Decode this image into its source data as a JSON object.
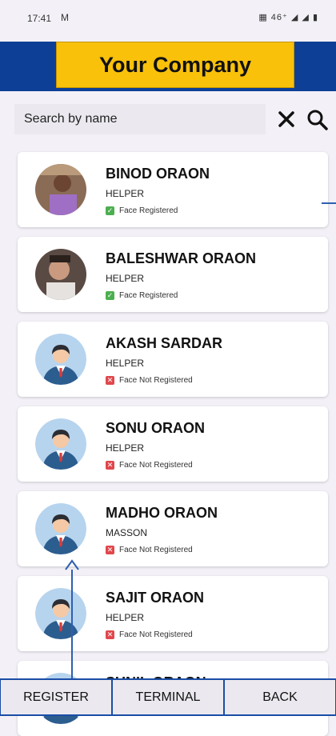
{
  "status_bar": {
    "time": "17:41",
    "net_icon": "M",
    "system": "▦ 46⁺ ◢ ◢ ▮"
  },
  "header": {
    "company": "Your Company"
  },
  "search": {
    "placeholder": "Search by name"
  },
  "employees": [
    {
      "name": "BINOD ORAON",
      "role": "HELPER",
      "face_status": "Face Registered",
      "registered": true,
      "avatar": "photo"
    },
    {
      "name": "BALESHWAR ORAON",
      "role": "HELPER",
      "face_status": "Face Registered",
      "registered": true,
      "avatar": "photo"
    },
    {
      "name": "AKASH SARDAR",
      "role": "HELPER",
      "face_status": "Face Not Registered",
      "registered": false,
      "avatar": "default-user"
    },
    {
      "name": "SONU ORAON",
      "role": "HELPER",
      "face_status": "Face Not Registered",
      "registered": false,
      "avatar": "default-user"
    },
    {
      "name": "MADHO ORAON",
      "role": "MASSON",
      "face_status": "Face Not Registered",
      "registered": false,
      "avatar": "default-user"
    },
    {
      "name": "SAJIT ORAON",
      "role": "HELPER",
      "face_status": "Face Not Registered",
      "registered": false,
      "avatar": "default-user"
    },
    {
      "name": "SUNIL ORAON",
      "role": "",
      "face_status": "",
      "registered": false,
      "avatar": "default-user"
    }
  ],
  "bottom_nav": {
    "register": "REGISTER",
    "terminal": "TERMINAL",
    "back": "BACK"
  },
  "colors": {
    "header_bg": "#0d3f96",
    "company_bg": "#f9c10a",
    "registered": "#4caf50",
    "not_registered": "#e0474c"
  }
}
